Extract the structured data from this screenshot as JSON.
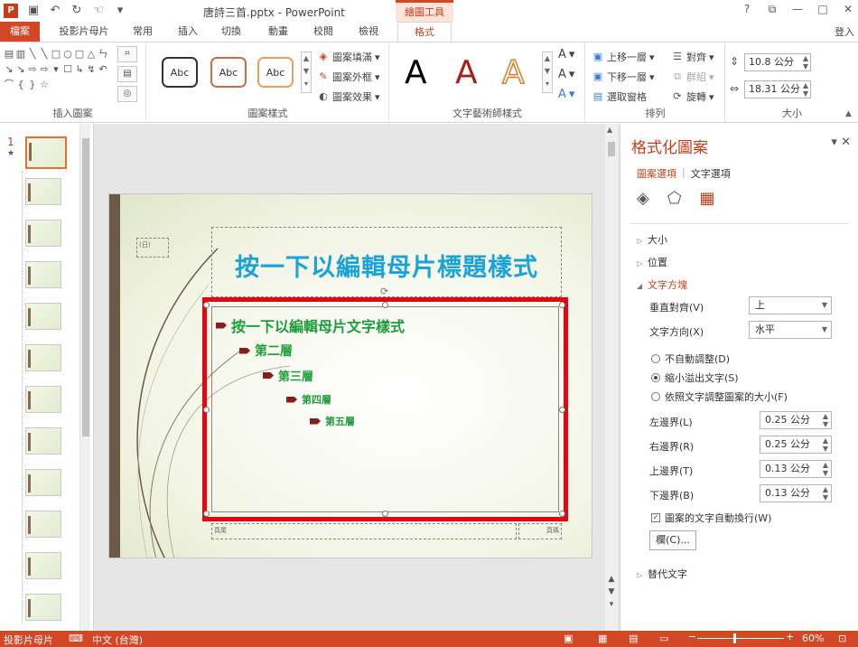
{
  "titlebar": {
    "app_icon": "P",
    "qat_icons": [
      "save-icon",
      "undo-icon",
      "redo-icon",
      "touch-mode-icon",
      "customize-icon"
    ],
    "qat_glyphs": [
      "▣",
      "↶",
      "↻",
      "☜",
      "▾"
    ],
    "title": "唐詩三首.pptx - PowerPoint",
    "context_tab": "繪圖工具",
    "window_controls": [
      "?",
      "⧉",
      "—",
      "□",
      "✕"
    ]
  },
  "tabs": {
    "file": "檔案",
    "items": [
      "投影片母片",
      "常用",
      "插入",
      "切換",
      "動畫",
      "校閱",
      "檢視",
      "格式"
    ],
    "sign_in": "登入"
  },
  "ribbon": {
    "insert_shapes": {
      "label": "插入圖案",
      "glyphs": [
        "▤",
        "▥",
        "╲",
        "╲",
        "□",
        "○",
        "□",
        "△",
        "ㄣ",
        "↘",
        "↘",
        "⇨",
        "⇨",
        "▾",
        "☐",
        "↳",
        "↯",
        "↶",
        "⌒",
        "{",
        "}",
        "☆"
      ]
    },
    "shape_styles": {
      "label": "圖案樣式",
      "sample": "Abc",
      "fill": "圖案填滿",
      "outline": "圖案外框",
      "effects": "圖案效果"
    },
    "wordart": {
      "label": "文字藝術師樣式",
      "glyph": "A"
    },
    "arrange": {
      "label": "排列",
      "bring_forward": "上移一層",
      "send_backward": "下移一層",
      "selection_pane": "選取窗格",
      "align": "對齊",
      "group": "群組",
      "rotate": "旋轉"
    },
    "size": {
      "label": "大小",
      "height": "10.8 公分",
      "width": "18.31 公分"
    }
  },
  "slides": {
    "selected_number": "1",
    "star": "★",
    "count": 12
  },
  "slide": {
    "title": "按一下以編輯母片標題樣式",
    "date_placeholder": "(日)",
    "footer_left": "頁尾",
    "footer_right": "頁碼",
    "levels": [
      {
        "text": "按一下以編輯母片文字樣式",
        "size": 16
      },
      {
        "text": "第二層",
        "size": 14
      },
      {
        "text": "第三層",
        "size": 13
      },
      {
        "text": "第四層",
        "size": 11
      },
      {
        "text": "第五層",
        "size": 11
      }
    ]
  },
  "pane": {
    "title": "格式化圖案",
    "tab_shape": "圖案選項",
    "tab_text": "文字選項",
    "sections": {
      "size": "大小",
      "position": "位置",
      "textbox": "文字方塊",
      "alt_text": "替代文字"
    },
    "vertical_align_label": "垂直對齊(V)",
    "vertical_align_value": "上",
    "text_direction_label": "文字方向(X)",
    "text_direction_value": "水平",
    "radio_no_autofit": "不自動調整(D)",
    "radio_shrink": "縮小溢出文字(S)",
    "radio_resize": "依照文字調整圖案的大小(F)",
    "left_margin_label": "左邊界(L)",
    "left_margin_value": "0.25 公分",
    "right_margin_label": "右邊界(R)",
    "right_margin_value": "0.25 公分",
    "top_margin_label": "上邊界(T)",
    "top_margin_value": "0.13 公分",
    "bottom_margin_label": "下邊界(B)",
    "bottom_margin_value": "0.13 公分",
    "wrap_label": "圖案的文字自動換行(W)",
    "columns_button": "欄(C)..."
  },
  "status": {
    "view": "投影片母片",
    "language": "中文 (台灣)",
    "zoom": "60%",
    "zoom_minus": "−",
    "zoom_plus": "+"
  },
  "colors": {
    "accent": "#d24726",
    "title_blue": "#1aa3d9",
    "body_green": "#1e9e3a",
    "bullet_red": "#8b1c1c",
    "highlight": "#e30613"
  }
}
